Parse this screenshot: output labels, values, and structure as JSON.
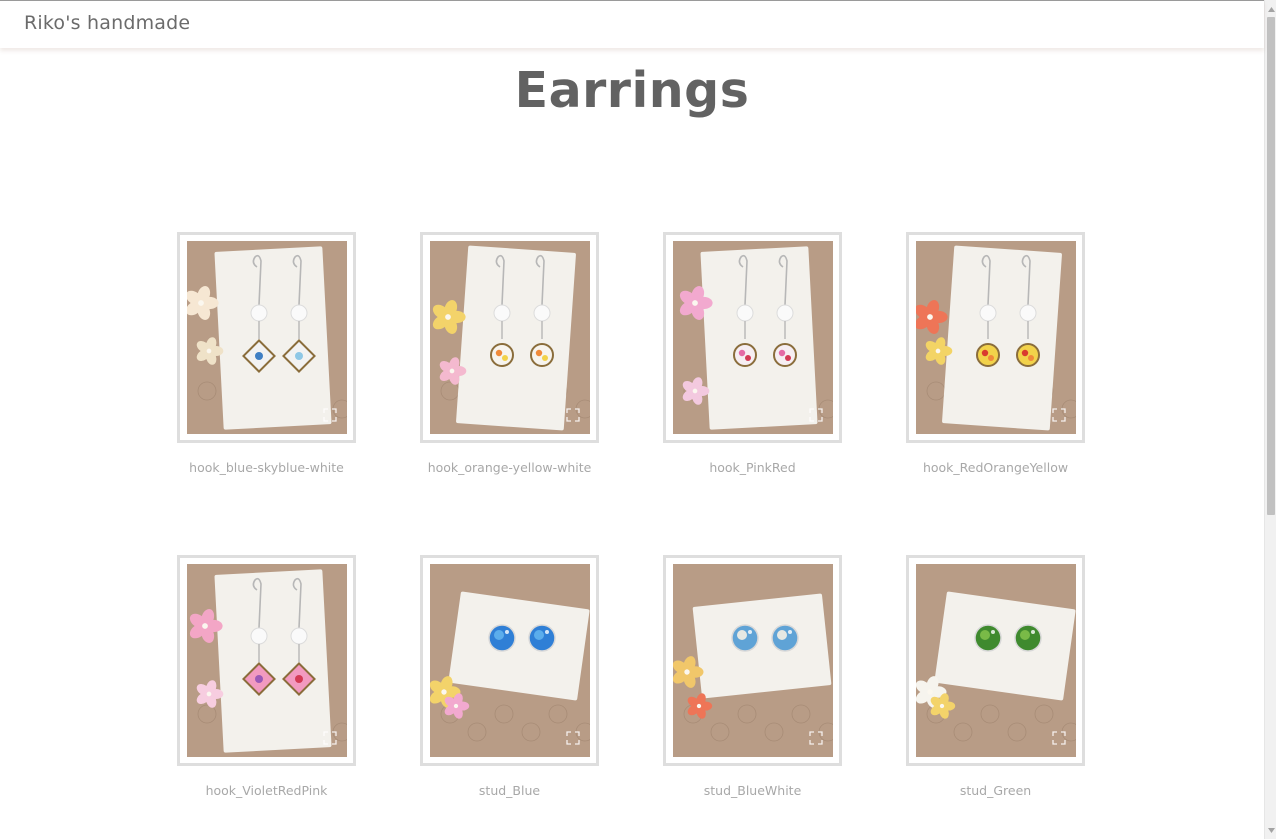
{
  "navbar": {
    "brand": "Riko's handmade"
  },
  "page": {
    "title": "Earrings"
  },
  "colors": {
    "title_text": "#626262",
    "caption_text": "#a8a8a8",
    "frame_border": "#dedede",
    "card_white": "#f3f1ec",
    "kraft_background": "#b89c86"
  },
  "products": [
    {
      "caption": "hook_blue-skyblue-white",
      "style": "hook",
      "pendant": "diamond",
      "colors": [
        "#3f7fc4",
        "#8ec7e6",
        "#f2f2f2"
      ],
      "icon": "expand-icon"
    },
    {
      "caption": "hook_orange-yellow-white",
      "style": "hook",
      "pendant": "circle",
      "colors": [
        "#f08a3a",
        "#f2d24a",
        "#f7f4ee"
      ],
      "icon": "expand-icon"
    },
    {
      "caption": "hook_PinkRed",
      "style": "hook",
      "pendant": "circle",
      "colors": [
        "#e46aa5",
        "#d33a55",
        "#f6eef2"
      ],
      "icon": "expand-icon"
    },
    {
      "caption": "hook_RedOrangeYellow",
      "style": "hook",
      "pendant": "circle",
      "colors": [
        "#d93a2f",
        "#f08a3a",
        "#f2d24a"
      ],
      "icon": "expand-icon"
    },
    {
      "caption": "hook_VioletRedPink",
      "style": "hook",
      "pendant": "diamond",
      "colors": [
        "#9b59b6",
        "#d33a55",
        "#f29ac0"
      ],
      "icon": "expand-icon"
    },
    {
      "caption": "stud_Blue",
      "style": "stud",
      "colors": [
        "#2f7fd6",
        "#61b3ee"
      ],
      "icon": "expand-icon"
    },
    {
      "caption": "stud_BlueWhite",
      "style": "stud",
      "colors": [
        "#5fa3d6",
        "#f4efe4"
      ],
      "icon": "expand-icon"
    },
    {
      "caption": "stud_Green",
      "style": "stud",
      "colors": [
        "#3f8a2e",
        "#7fbf4a"
      ],
      "icon": "expand-icon"
    }
  ]
}
